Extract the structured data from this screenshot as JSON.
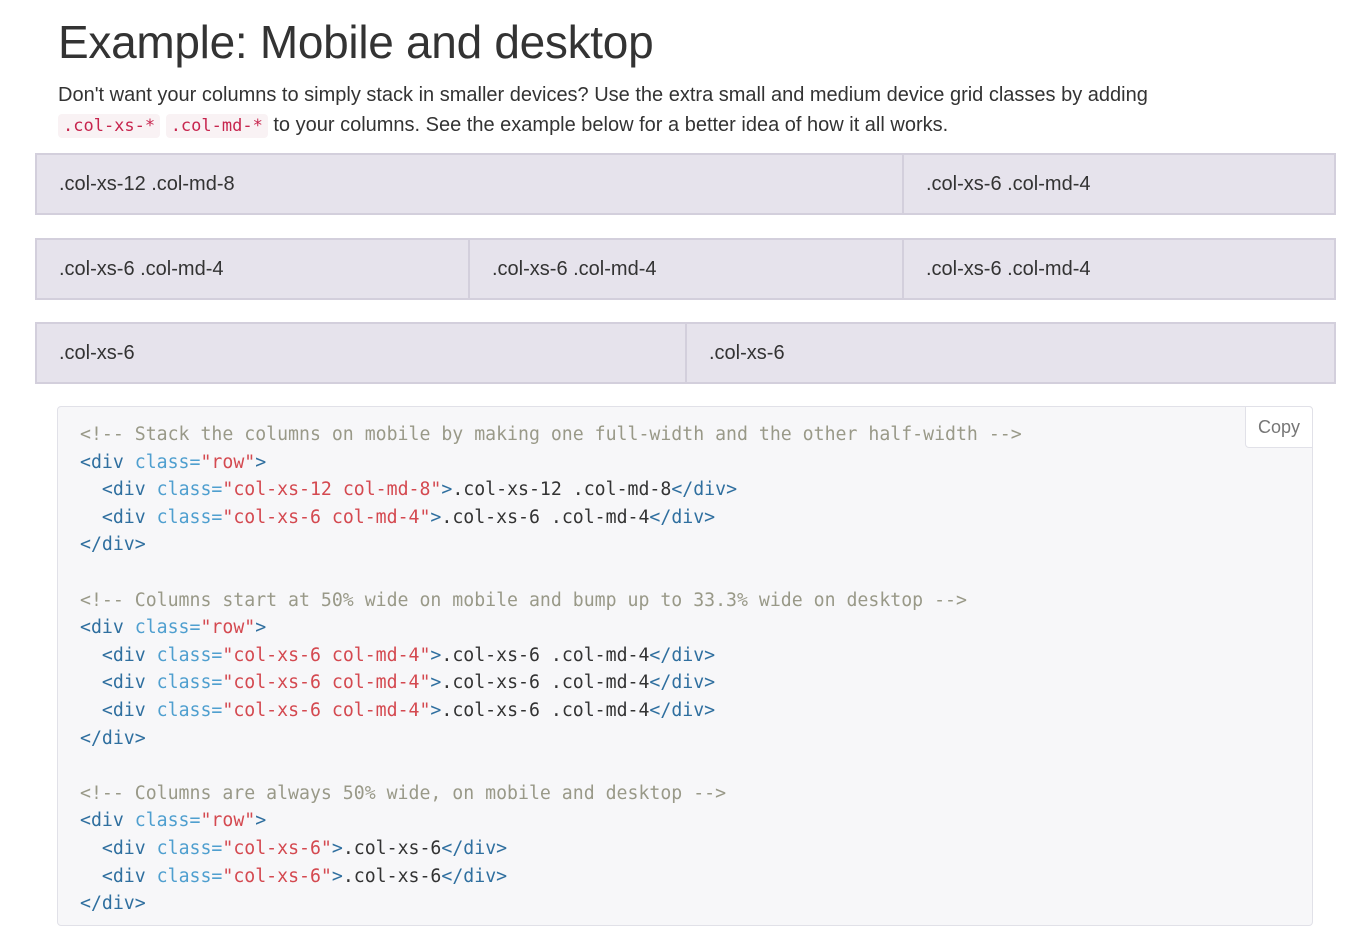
{
  "title": "Example: Mobile and desktop",
  "intro": {
    "line1": "Don't want your columns to simply stack in smaller devices? Use the extra small and medium device grid classes by adding",
    "code1": ".col-xs-*",
    "code2": ".col-md-*",
    "line2": " to your columns. See the example below for a better idea of how it all works."
  },
  "grid_rows": [
    [
      ".col-xs-12 .col-md-8",
      ".col-xs-6 .col-md-4"
    ],
    [
      ".col-xs-6 .col-md-4",
      ".col-xs-6 .col-md-4",
      ".col-xs-6 .col-md-4"
    ],
    [
      ".col-xs-6",
      ".col-xs-6"
    ]
  ],
  "copy_label": "Copy",
  "code": {
    "c1": "<!-- Stack the columns on mobile by making one full-width and the other half-width -->",
    "c2": "<!-- Columns start at 50% wide on mobile and bump up to 33.3% wide on desktop -->",
    "c3": "<!-- Columns are always 50% wide, on mobile and desktop -->",
    "open_tag": "<div",
    "attr": " class=",
    "row_val": "\"row\"",
    "close_open": ">",
    "close_tag": "</div>",
    "v_xs12md8": "\"col-xs-12 col-md-8\"",
    "v_xs6md4": "\"col-xs-6 col-md-4\"",
    "v_xs6": "\"col-xs-6\"",
    "t_xs12md8": ".col-xs-12 .col-md-8",
    "t_xs6md4": ".col-xs-6 .col-md-4",
    "t_xs6": ".col-xs-6",
    "indent": "  "
  }
}
